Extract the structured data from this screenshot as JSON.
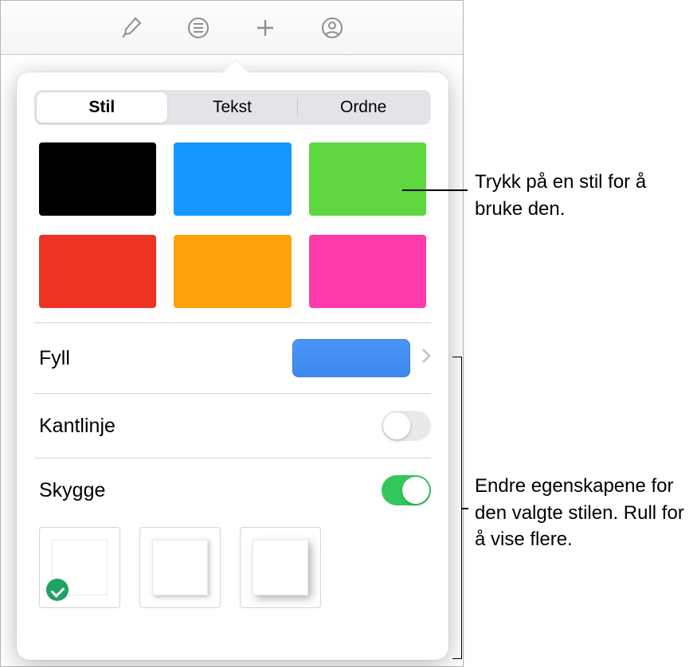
{
  "toolbar": {
    "icons": [
      "paint-brush-icon",
      "list-icon",
      "plus-icon",
      "collaborate-icon"
    ]
  },
  "segmented": {
    "items": [
      "Stil",
      "Tekst",
      "Ordne"
    ],
    "selected_index": 0
  },
  "swatches": [
    {
      "name": "black",
      "color": "#000000"
    },
    {
      "name": "blue",
      "color": "#1498ff"
    },
    {
      "name": "green",
      "color": "#5dd63f"
    },
    {
      "name": "red",
      "color": "#ed3423"
    },
    {
      "name": "orange",
      "color": "#ffa20b"
    },
    {
      "name": "pink",
      "color": "#ff3aab"
    }
  ],
  "rows": {
    "fill": {
      "label": "Fyll",
      "swatch_color": "#4a96f5"
    },
    "border": {
      "label": "Kantlinje",
      "toggle": false
    },
    "shadow": {
      "label": "Skygge",
      "toggle": true
    }
  },
  "shadow_presets": {
    "selected_index": 0,
    "count": 3
  },
  "callouts": {
    "style_tap": "Trykk på en stil for å bruke den.",
    "properties": "Endre egenskapene for den valgte stilen. Rull for å vise flere."
  }
}
